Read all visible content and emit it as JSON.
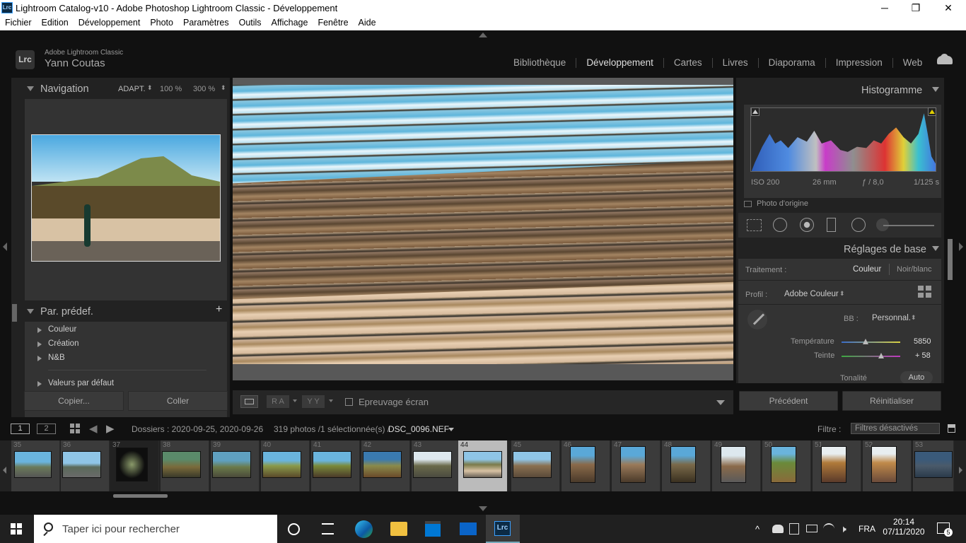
{
  "window": {
    "title": "Lightroom Catalog-v10 - Adobe Photoshop Lightroom Classic - Développement",
    "app_badge": "Lrc",
    "min": "─",
    "max": "❐",
    "close": "✕"
  },
  "menu": [
    "Fichier",
    "Edition",
    "Développement",
    "Photo",
    "Paramètres",
    "Outils",
    "Affichage",
    "Fenêtre",
    "Aide"
  ],
  "identity": {
    "badge": "Lrc",
    "product": "Adobe Lightroom Classic",
    "user": "Yann Coutas"
  },
  "modules": [
    "Bibliothèque",
    "Développement",
    "Cartes",
    "Livres",
    "Diaporama",
    "Impression",
    "Web"
  ],
  "navigator": {
    "title": "Navigation",
    "fit": "ADAPT.",
    "z1": "100 %",
    "z2": "300 %"
  },
  "presets": {
    "title": "Par. prédef.",
    "add": "+",
    "items": [
      "Couleur",
      "Création",
      "N&B",
      "Valeurs par défaut"
    ]
  },
  "left_buttons": {
    "copy": "Copier...",
    "paste": "Coller"
  },
  "toolbar": {
    "softproof": "Epreuvage écran",
    "ra": "R A",
    "yy": "Y Y"
  },
  "histogram": {
    "title": "Histogramme",
    "iso": "ISO 200",
    "focal": "26 mm",
    "aperture": "ƒ / 8,0",
    "shutter": "1/125 s",
    "original": "Photo d'origine"
  },
  "basic": {
    "title": "Réglages de base",
    "treatment_label": "Traitement :",
    "color": "Couleur",
    "bw": "Noir/blanc",
    "profile_label": "Profil :",
    "profile": "Adobe Couleur",
    "wb_label": "BB :",
    "wb": "Personnal.",
    "temp_label": "Température",
    "temp": "5850",
    "tint_label": "Teinte",
    "tint": "+ 58",
    "tone_label": "Tonalité",
    "auto": "Auto"
  },
  "right_buttons": {
    "previous": "Précédent",
    "reset": "Réinitialiser"
  },
  "filmbar": {
    "screen1": "1",
    "screen2": "2",
    "source": "Dossiers : 2020-09-25, 2020-09-26",
    "count": "319 photos /1 sélectionnée(s) /",
    "file": "DSC_0096.NEF",
    "filter_label": "Filtre :",
    "filter": "Filtres désactivés"
  },
  "thumbnails": [
    "35",
    "36",
    "37",
    "38",
    "39",
    "40",
    "41",
    "42",
    "43",
    "44",
    "45",
    "46",
    "47",
    "48",
    "49",
    "50",
    "51",
    "52",
    "53"
  ],
  "taskbar": {
    "search": "Taper ici pour rechercher",
    "lang": "FRA",
    "time": "20:14",
    "date": "07/11/2020",
    "notif": "5"
  }
}
